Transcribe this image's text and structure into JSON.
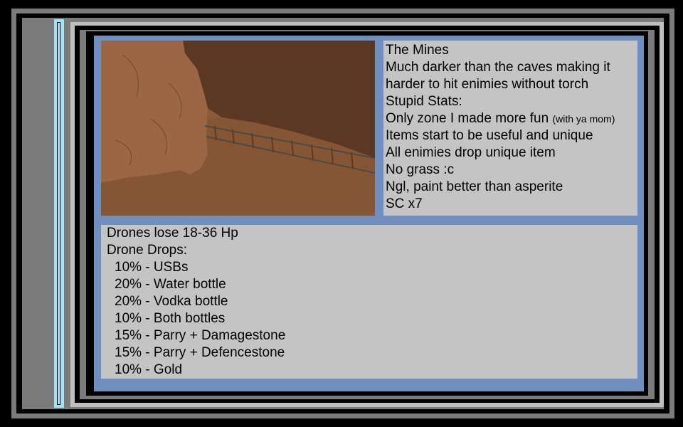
{
  "info": {
    "title": "The Mines",
    "desc1": "Much darker than the caves making it",
    "desc2": "harder to hit enimies without torch",
    "stats_header": "Stupid Stats:",
    "stat1_main": "Only zone I made more fun",
    "stat1_note": "(with ya mom)",
    "stat2": "Items start to be useful and unique",
    "stat3": "All enimies drop unique item",
    "stat4": "No grass :c",
    "stat5": "Ngl, paint better than asperite",
    "stat6": "SC x7"
  },
  "drops": {
    "hp_line": "Drones lose 18-36 Hp",
    "header": "Drone Drops:",
    "items": [
      "10% - USBs",
      "20% - Water bottle",
      "20% - Vodka bottle",
      "10% - Both bottles",
      "15% - Parry + Damagestone",
      "15% - Parry + Defencestone",
      "10% - Gold"
    ]
  },
  "colors": {
    "panel_blue": "#6f8fbf",
    "text_box_gray": "#c4c4c4",
    "accent_cyan": "#9fe3f4",
    "cave_floor": "#8b5a39",
    "cave_dark": "#5a3823"
  }
}
